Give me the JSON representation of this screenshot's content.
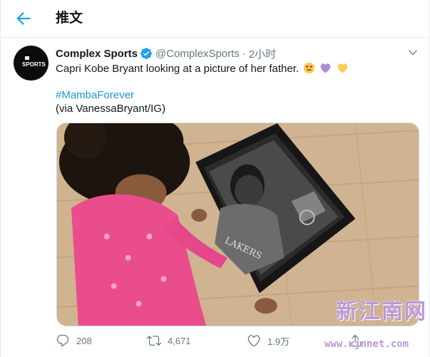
{
  "header": {
    "title": "推文",
    "back_icon": "arrow-left-icon",
    "accent": "#1da1f2"
  },
  "tweet": {
    "avatar_text": "SPORTS",
    "display_name": "Complex Sports",
    "verified": true,
    "handle": "@ComplexSports",
    "separator": "·",
    "time": "2小时",
    "text": "Capri Kobe Bryant looking at a picture of her father.",
    "emojis": [
      "smiling-face-with-heart-eyes",
      "purple-heart",
      "yellow-heart"
    ],
    "hashtag": "#MambaForever",
    "credit": "(via VanessaBryant/IG)",
    "media_alt": "photo"
  },
  "actions": {
    "replies": "208",
    "retweets": "4,671",
    "likes": "1.9万"
  },
  "watermark": {
    "title": "新江南网",
    "url": "www.xjnnet.com"
  },
  "colors": {
    "link": "#1b95e0",
    "muted": "#657786",
    "border": "#e6ecf0"
  }
}
